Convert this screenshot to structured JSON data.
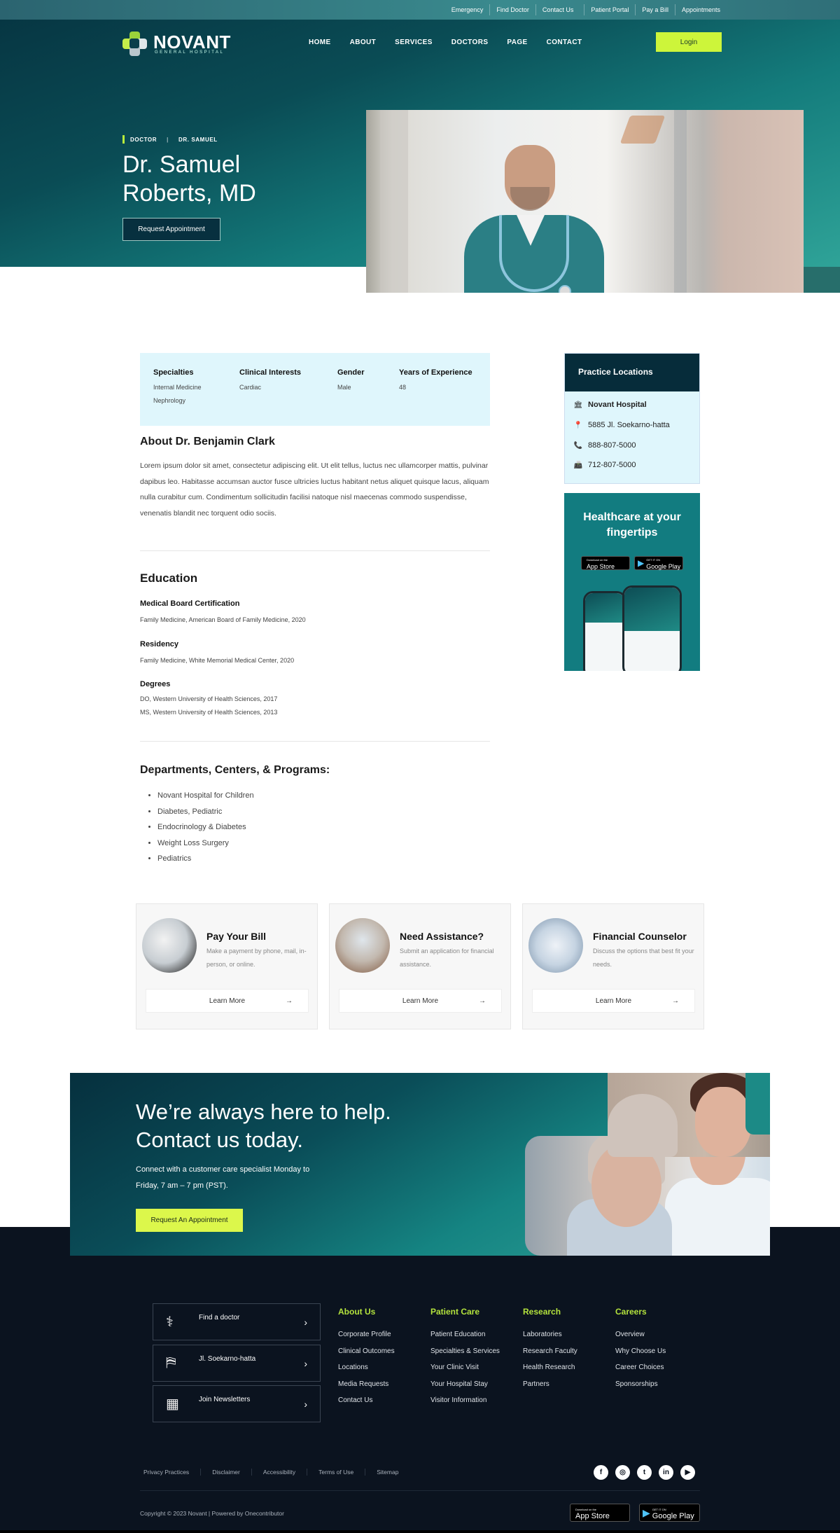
{
  "topbar": {
    "links": [
      "Emergency",
      "Find Doctor",
      "Contact Us",
      "Patient Portal",
      "Pay a Bill",
      "Appointments"
    ]
  },
  "brand": {
    "name": "NOVANT",
    "tagline": "GENERAL HOSPITAL",
    "colors": {
      "accent": "#cdf53a",
      "dark": "#062c3a",
      "teal": "#127c80",
      "footer": "#0b131f"
    }
  },
  "nav": {
    "items": [
      "HOME",
      "ABOUT",
      "SERVICES",
      "DOCTORS",
      "PAGE",
      "CONTACT"
    ],
    "login": "Login"
  },
  "hero": {
    "breadcrumb": [
      "DOCTOR",
      "DR. SAMUEL"
    ],
    "title_line1": "Dr. Samuel",
    "title_line2": "Roberts, MD",
    "button": "Request Appointment"
  },
  "info": {
    "columns": [
      {
        "label": "Specialties",
        "values": [
          "Internal Medicine",
          "Nephrology"
        ]
      },
      {
        "label": "Clinical Interests",
        "values": [
          "Cardiac"
        ]
      },
      {
        "label": "Gender",
        "values": [
          "Male"
        ]
      },
      {
        "label": "Years of Experience",
        "values": [
          "48"
        ]
      }
    ]
  },
  "about": {
    "title": "About Dr. Benjamin Clark",
    "text": "Lorem ipsum dolor sit amet, consectetur adipiscing elit. Ut elit tellus, luctus nec ullamcorper mattis, pulvinar dapibus leo. Habitasse accumsan auctor fusce ultricies luctus habitant netus aliquet quisque lacus, aliquam  nulla curabitur cum. Condimentum sollicitudin  facilisi natoque nisl maecenas commodo suspendisse, venenatis blandit nec torquent odio sociis."
  },
  "education": {
    "title": "Education",
    "sections": [
      {
        "heading": "Medical Board Certification",
        "lines": [
          "Family Medicine, American Board of Family Medicine, 2020"
        ]
      },
      {
        "heading": "Residency",
        "lines": [
          "Family Medicine, White Memorial Medical Center, 2020"
        ]
      },
      {
        "heading": "Degrees",
        "lines": [
          "DO, Western University of Health Sciences, 2017",
          "MS, Western University of Health Sciences, 2013"
        ]
      }
    ]
  },
  "departments": {
    "title": "Departments, Centers, & Programs:",
    "items": [
      "Novant Hospital for Children",
      "Diabetes, Pediatric",
      "Endocrinology & Diabetes",
      "Weight Loss Surgery",
      "Pediatrics"
    ]
  },
  "practice": {
    "title": "Practice Locations",
    "items": [
      {
        "icon": "building-icon",
        "text": "Novant Hospital"
      },
      {
        "icon": "map-pin-icon",
        "text": "5885 Jl. Soekarno-hatta"
      },
      {
        "icon": "phone-icon",
        "text": "888-807-5000"
      },
      {
        "icon": "fax-icon",
        "text": "712-807-5000"
      }
    ]
  },
  "app_promo": {
    "title_line1": "Healthcare at your",
    "title_line2": "fingertips",
    "app_store_small": "Download on the",
    "app_store": "App Store",
    "google_small": "GET IT ON",
    "google": "Google Play"
  },
  "services": [
    {
      "title": "Pay Your Bill",
      "desc": "Make a payment by phone, mail, in-person, or online.",
      "button": "Learn More"
    },
    {
      "title": "Need Assistance?",
      "desc": "Submit an application for financial assistance.",
      "button": "Learn More"
    },
    {
      "title": "Financial Counselor",
      "desc": "Discuss the options that best fit your needs.",
      "button": "Learn More"
    }
  ],
  "cta": {
    "title_line1": "We’re always here to help.",
    "title_line2": "Contact us today.",
    "text": "Connect with a customer care specialist Monday to Friday, 7 am – 7 pm (PST).",
    "button": "Request An Appointment"
  },
  "footer": {
    "quick_links": [
      {
        "icon": "stethoscope-icon",
        "label": "Find a doctor"
      },
      {
        "icon": "map-location-icon",
        "label": "Jl. Soekarno-hatta"
      },
      {
        "icon": "newspaper-icon",
        "label": "Join Newsletters"
      }
    ],
    "columns": [
      {
        "title": "About Us",
        "links": [
          "Corporate Profile",
          "Clinical Outcomes",
          "Locations",
          "Media Requests",
          "Contact Us"
        ]
      },
      {
        "title": "Patient Care",
        "links": [
          "Patient Education",
          "Specialties & Services",
          "Your Clinic Visit",
          "Your Hospital Stay",
          "Visitor Information"
        ]
      },
      {
        "title": "Research",
        "links": [
          "Laboratories",
          "Research Faculty",
          "Health Research",
          "Partners"
        ]
      },
      {
        "title": "Careers",
        "links": [
          "Overview",
          "Why Choose Us",
          "Career Choices",
          "Sponsorships"
        ]
      }
    ],
    "legal": [
      "Privacy Practices",
      "Disclaimer",
      "Accessibility",
      "Terms of Use",
      "Sitemap"
    ],
    "social": [
      "facebook-icon",
      "instagram-icon",
      "twitter-icon",
      "linkedin-icon",
      "youtube-icon"
    ],
    "copyright": "Copyright © 2023 Novant | Powered by Onecontributor",
    "app_store_small": "Download on the",
    "app_store": "App Store",
    "google_small": "GET IT ON",
    "google": "Google Play"
  }
}
